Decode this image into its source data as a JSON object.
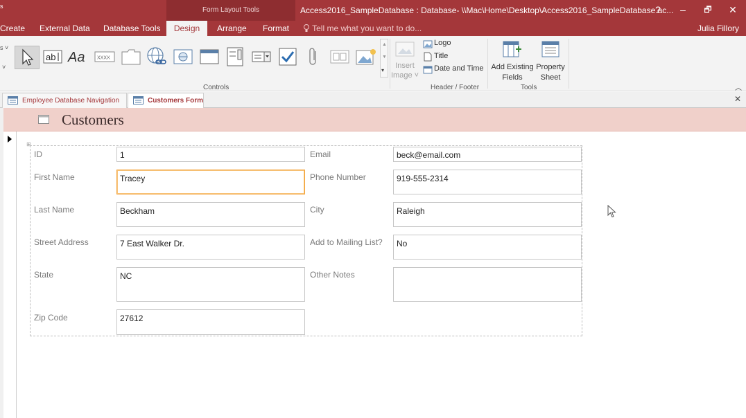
{
  "titlebar": {
    "left_fragment": "s",
    "context_tab": "Form Layout Tools",
    "window_title": "Access2016_SampleDatabase : Database- \\\\Mac\\Home\\Desktop\\Access2016_SampleDatabase.ac...",
    "help": "?",
    "minimize": "–",
    "restore": "🗗",
    "close": "✕"
  },
  "ribbon_tabs": {
    "create": "Create",
    "external_data": "External Data",
    "database_tools": "Database Tools",
    "design": "Design",
    "arrange": "Arrange",
    "format": "Format",
    "tell_me": "Tell me what you want to do...",
    "user": "Julia Fillory"
  },
  "ribbon": {
    "controls_label": "Controls",
    "insert_image_1": "Insert",
    "insert_image_2": "Image ˅",
    "logo": "Logo",
    "title": "Title",
    "date_time": "Date and Time",
    "header_footer_label": "Header / Footer",
    "add_existing_1": "Add Existing",
    "add_existing_2": "Fields",
    "property_1": "Property",
    "property_2": "Sheet",
    "tools_label": "Tools",
    "left_fragment_1": "s ˅",
    "left_fragment_2": "˅"
  },
  "doc_tabs": {
    "nav": "Employee Database Navigation",
    "customers": "Customers Form",
    "close": "✕"
  },
  "form": {
    "title": "Customers",
    "fields": {
      "id_label": "ID",
      "id_value": "1",
      "first_name_label": "First Name",
      "first_name_value": "Tracey",
      "last_name_label": "Last Name",
      "last_name_value": "Beckham",
      "street_label": "Street Address",
      "street_value": "7 East Walker Dr.",
      "state_label": "State",
      "state_value": "NC",
      "zip_label": "Zip Code",
      "zip_value": "27612",
      "email_label": "Email",
      "email_value": "beck@email.com",
      "phone_label": "Phone Number",
      "phone_value": "919-555-2314",
      "city_label": "City",
      "city_value": "Raleigh",
      "mailing_label": "Add to Mailing List?",
      "mailing_value": "No",
      "notes_label": "Other Notes",
      "notes_value": ""
    }
  },
  "colors": {
    "accent": "#a4373a",
    "header_band": "#f0d0ca",
    "focus_border": "#f3a33a"
  }
}
